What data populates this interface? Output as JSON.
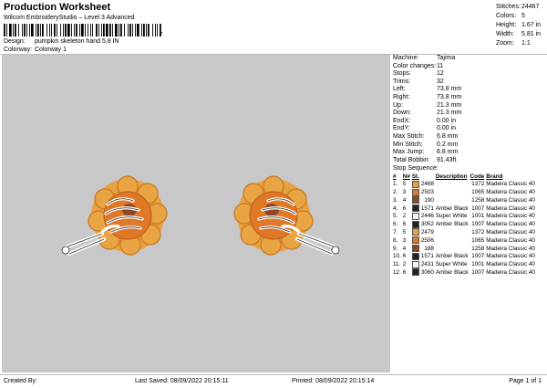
{
  "header": {
    "title": "Production Worksheet",
    "subtitle": "Wilcom EmbroideryStudio – Level 3 Advanced",
    "barcode_suffix": ",",
    "design_label": "Design:",
    "design_value": "pumpkin skeleton hand 5,8 IN",
    "colorway_label": "Colorway:",
    "colorway_value": "Colorway 1"
  },
  "stats": [
    {
      "k": "Stitches:",
      "v": "24467"
    },
    {
      "k": "Colors:",
      "v": "5"
    },
    {
      "k": "Height:",
      "v": "1.67 in"
    },
    {
      "k": "Width:",
      "v": "5.81 in"
    },
    {
      "k": "Zoom:",
      "v": "1:1"
    }
  ],
  "info": [
    {
      "k": "Machine:",
      "v": "Tajima"
    },
    {
      "k": "Color changes:",
      "v": "11"
    },
    {
      "k": "Stops:",
      "v": "12"
    },
    {
      "k": "Trims:",
      "v": "32"
    },
    {
      "k": "Left:",
      "v": "73.8 mm"
    },
    {
      "k": "Right:",
      "v": "73.8 mm"
    },
    {
      "k": "Up:",
      "v": "21.3 mm"
    },
    {
      "k": "Down:",
      "v": "21.3 mm"
    },
    {
      "k": "EndX:",
      "v": "0.00 in"
    },
    {
      "k": "EndY:",
      "v": "0.00 in"
    },
    {
      "k": "Max Stitch:",
      "v": "6.8 mm"
    },
    {
      "k": "Min Stitch:",
      "v": "0.2 mm"
    },
    {
      "k": "Max Jump:",
      "v": "6.8 mm"
    },
    {
      "k": "Total Bobbin:",
      "v": "91.43ft"
    }
  ],
  "sequence": {
    "title": "Stop Sequence:",
    "headers": [
      "#",
      "N#",
      "St.",
      "Description",
      "Code",
      "Brand"
    ],
    "rows": [
      {
        "n": "1.",
        "nn": "5",
        "color": "#e8a040",
        "st": "2468",
        "desc": "",
        "code": "1372",
        "brand": "Madeira Classic 40"
      },
      {
        "n": "2.",
        "nn": "3",
        "color": "#e07828",
        "st": "2503",
        "desc": "",
        "code": "1065",
        "brand": "Madeira Classic 40"
      },
      {
        "n": "3.",
        "nn": "4",
        "color": "#8a4a2a",
        "st": "190",
        "desc": "",
        "code": "1258",
        "brand": "Madeira Classic 40"
      },
      {
        "n": "4.",
        "nn": "6",
        "color": "#222222",
        "st": "1571",
        "desc": "Amber Black",
        "code": "1007",
        "brand": "Madeira Classic 40"
      },
      {
        "n": "5.",
        "nn": "2",
        "color": "#f2f2f6",
        "st": "2446",
        "desc": "Super White",
        "code": "1001",
        "brand": "Madeira Classic 40"
      },
      {
        "n": "6.",
        "nn": "6",
        "color": "#222222",
        "st": "3052",
        "desc": "Amber Black",
        "code": "1007",
        "brand": "Madeira Classic 40"
      },
      {
        "n": "7.",
        "nn": "5",
        "color": "#e8a040",
        "st": "2479",
        "desc": "",
        "code": "1372",
        "brand": "Madeira Classic 40"
      },
      {
        "n": "8.",
        "nn": "3",
        "color": "#e07828",
        "st": "2506",
        "desc": "",
        "code": "1065",
        "brand": "Madeira Classic 40"
      },
      {
        "n": "9.",
        "nn": "4",
        "color": "#8a4a2a",
        "st": "188",
        "desc": "",
        "code": "1258",
        "brand": "Madeira Classic 40"
      },
      {
        "n": "10.",
        "nn": "6",
        "color": "#222222",
        "st": "1571",
        "desc": "Amber Black",
        "code": "1007",
        "brand": "Madeira Classic 40"
      },
      {
        "n": "11.",
        "nn": "2",
        "color": "#f2f2f6",
        "st": "2431",
        "desc": "Super White",
        "code": "1001",
        "brand": "Madeira Classic 40"
      },
      {
        "n": "12.",
        "nn": "6",
        "color": "#222222",
        "st": "3060",
        "desc": "Amber Black",
        "code": "1007",
        "brand": "Madeira Classic 40"
      }
    ]
  },
  "footer": {
    "created_by": "Created By:",
    "last_saved": "Last Saved: 08/09/2022 20:15:11",
    "printed": "Printed: 08/09/2022 20:15:14",
    "page": "Page 1 of 1"
  }
}
